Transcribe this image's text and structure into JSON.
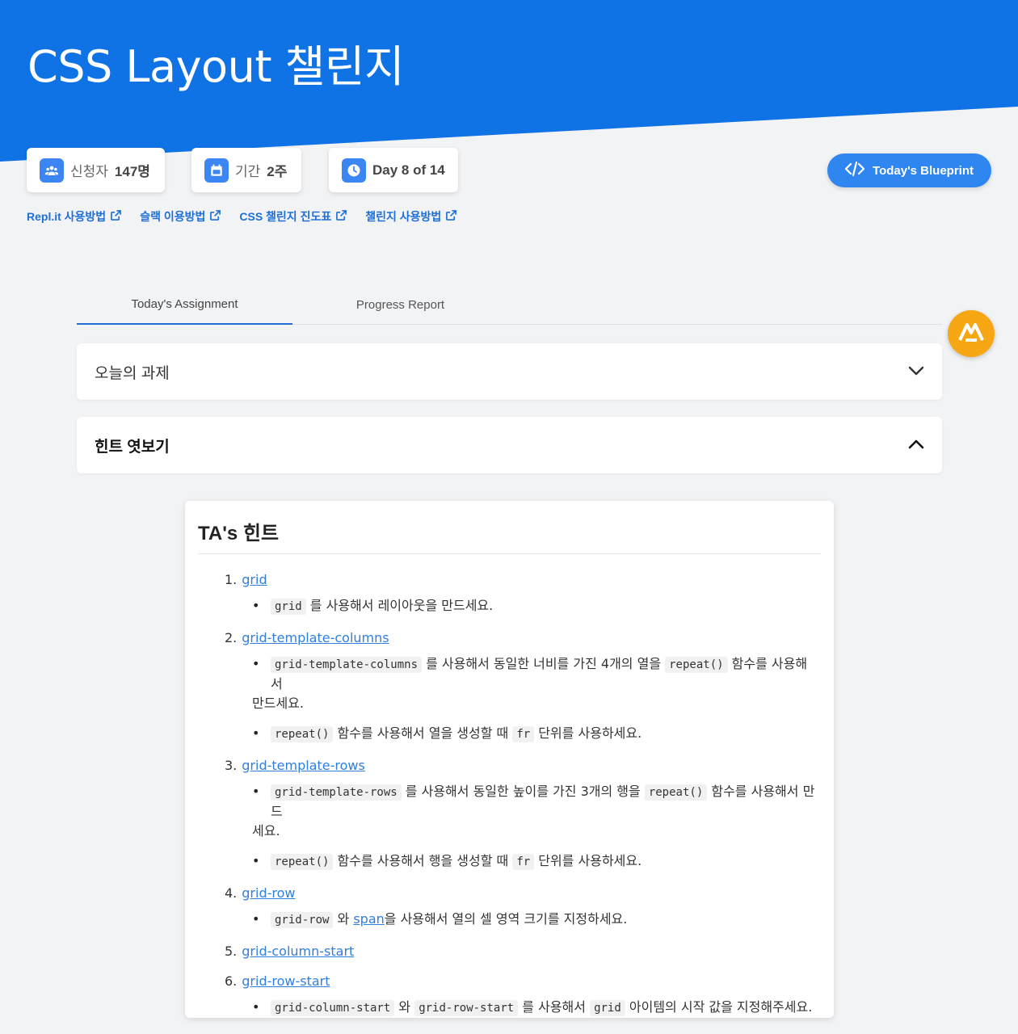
{
  "hero": {
    "title": "CSS Layout 챌린지"
  },
  "stats": [
    {
      "label": "신청자",
      "value": "147명",
      "icon": "people-icon"
    },
    {
      "label": "기간",
      "value": "2주",
      "icon": "calendar-icon"
    },
    {
      "label": "",
      "value": "Day 8 of 14",
      "icon": "clock-icon"
    }
  ],
  "blueprint": {
    "label": "Today's Blueprint",
    "icon": "code-icon"
  },
  "links": [
    "Repl.it 사용방법",
    "슬랙 이용방법",
    "CSS 챌린지 진도표",
    "챌린지 사용방법"
  ],
  "tabs": [
    "Today's Assignment",
    "Progress Report"
  ],
  "panels": {
    "assignment": "오늘의 과제",
    "hints": "힌트 엿보기"
  },
  "hint_card": {
    "title": "TA's 힌트",
    "items": [
      {
        "num": "1.",
        "link": "grid"
      },
      {
        "num": "2.",
        "link": "grid-template-columns"
      },
      {
        "num": "3.",
        "link": "grid-template-rows"
      },
      {
        "num": "4.",
        "link": "grid-row"
      },
      {
        "num": "5.",
        "link": "grid-column-start"
      },
      {
        "num": "6.",
        "link": "grid-row-start"
      }
    ],
    "sub1": {
      "code": "grid",
      "text": " 를 사용해서 레이아웃을 만드세요."
    },
    "sub2a": {
      "code1": "grid-template-columns",
      "t1": " 를 사용해서 동일한 너비를 가진 4개의 열을 ",
      "code2": "repeat()",
      "t2": " 함수를 사용해서",
      "t3": "만드세요."
    },
    "sub2b": {
      "code1": "repeat()",
      "t1": " 함수를 사용해서 열을 생성할 때 ",
      "code2": "fr",
      "t2": " 단위를 사용하세요."
    },
    "sub3a": {
      "code1": "grid-template-rows",
      "t1": " 를 사용해서 동일한 높이를 가진 3개의 행을 ",
      "code2": "repeat()",
      "t2": " 함수를 사용해서 만드",
      "t3": "세요."
    },
    "sub3b": {
      "code1": "repeat()",
      "t1": " 함수를 사용해서 행을 생성할 때 ",
      "code2": "fr",
      "t2": " 단위를 사용하세요."
    },
    "sub4": {
      "code1": "grid-row",
      "t1": " 와 ",
      "link": "span",
      "t2": "을 사용해서 열의 셀 영역 크기를 지정하세요."
    },
    "sub6": {
      "code1": "grid-column-start",
      "t1": " 와 ",
      "code2": "grid-row-start",
      "t2": " 를 사용해서 ",
      "code3": "grid",
      "t3": " 아이템의 시작 값을 지정해주세요."
    }
  },
  "colors": {
    "brand": "#0f72e5",
    "accent": "#2f86f0",
    "link": "#1f6fd6",
    "chat": "#f7a713"
  }
}
